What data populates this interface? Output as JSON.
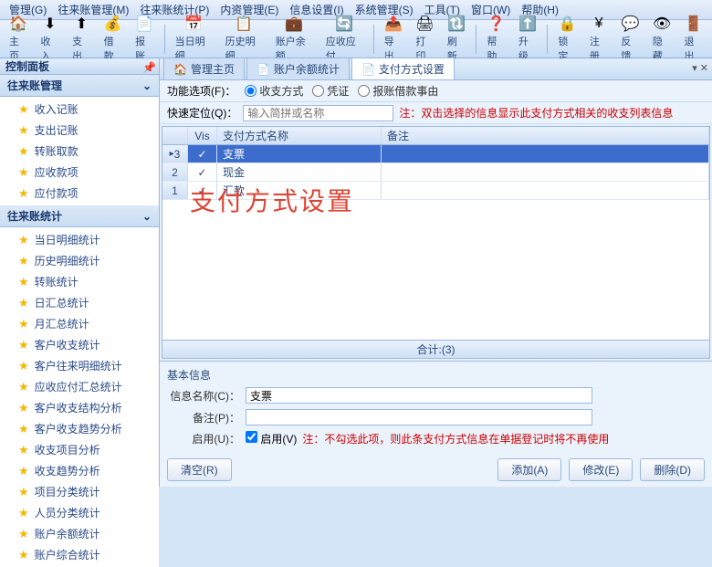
{
  "menu": {
    "manage": "管理(G)",
    "ledger": "往来账管理(M)",
    "stats": "往来账统计(P)",
    "content": "内资管理(E)",
    "info": "信息设置(I)",
    "sys": "系统管理(S)",
    "tools": "工具(T)",
    "window": "窗口(W)",
    "help": "帮助(H)"
  },
  "toolbar": [
    {
      "icon": "🏠",
      "label": "主页"
    },
    {
      "icon": "⬇",
      "label": "收入"
    },
    {
      "icon": "⬆",
      "label": "支出"
    },
    {
      "icon": "💰",
      "label": "借款"
    },
    {
      "icon": "📄",
      "label": "报账"
    },
    {
      "sep": true
    },
    {
      "icon": "📅",
      "label": "当日明细"
    },
    {
      "icon": "📋",
      "label": "历史明细"
    },
    {
      "icon": "💼",
      "label": "账户余额"
    },
    {
      "icon": "🔄",
      "label": "应收应付"
    },
    {
      "sep": true
    },
    {
      "icon": "📤",
      "label": "导出"
    },
    {
      "icon": "🖨",
      "label": "打印"
    },
    {
      "icon": "🔃",
      "label": "刷新"
    },
    {
      "sep": true
    },
    {
      "icon": "❓",
      "label": "帮助"
    },
    {
      "icon": "⬆️",
      "label": "升级"
    },
    {
      "sep": true
    },
    {
      "icon": "🔒",
      "label": "锁定"
    },
    {
      "icon": "¥",
      "label": "注册"
    },
    {
      "icon": "💬",
      "label": "反馈"
    },
    {
      "icon": "👁",
      "label": "隐藏"
    },
    {
      "icon": "🚪",
      "label": "退出"
    }
  ],
  "sidebar": {
    "title": "控制面板",
    "groups": [
      {
        "title": "往来账管理",
        "items": [
          "收入记账",
          "支出记账",
          "转账取款",
          "应收款项",
          "应付款项"
        ]
      },
      {
        "title": "往来账统计",
        "items": [
          "当日明细统计",
          "历史明细统计",
          "转账统计",
          "日汇总统计",
          "月汇总统计",
          "客户收支统计",
          "客户往来明细统计",
          "应收应付汇总统计",
          "客户收支结构分析",
          "客户收支趋势分析",
          "收支项目分析",
          "收支趋势分析",
          "项目分类统计",
          "人员分类统计",
          "账户余额统计",
          "账户综合统计"
        ]
      }
    ]
  },
  "tabs": {
    "t1": "管理主页",
    "t2": "账户余额统计",
    "t3": "支付方式设置"
  },
  "func": {
    "label": "功能选项(F)：",
    "opt1": "收支方式",
    "opt2": "凭证",
    "opt3": "报账借款事由"
  },
  "quick": {
    "label": "快速定位(Q)：",
    "placeholder": "输入简拼或名称",
    "note": "注：双击选择的信息显示此支付方式相关的收支列表信息"
  },
  "grid": {
    "cols": {
      "vis": "Vis",
      "name": "支付方式名称",
      "note": "备注"
    },
    "rows": [
      {
        "n": "1",
        "vis": "✓",
        "name": "汇款",
        "note": ""
      },
      {
        "n": "2",
        "vis": "✓",
        "name": "现金",
        "note": ""
      },
      {
        "n": "3",
        "vis": "✓",
        "name": "支票",
        "note": ""
      }
    ],
    "footer": "合计:(3)",
    "watermark": "支付方式设置"
  },
  "basic": {
    "title": "基本信息",
    "name_lbl": "信息名称(C)：",
    "name_val": "支票",
    "note_lbl": "备注(P)：",
    "note_val": "",
    "enable_lbl": "启用(U)：",
    "enable_chk": "启用(V)",
    "enable_note": "注：不勾选此项，则此条支付方式信息在单据登记时将不再使用"
  },
  "btns": {
    "clear": "清空(R)",
    "add": "添加(A)",
    "edit": "修改(E)",
    "del": "删除(D)"
  }
}
